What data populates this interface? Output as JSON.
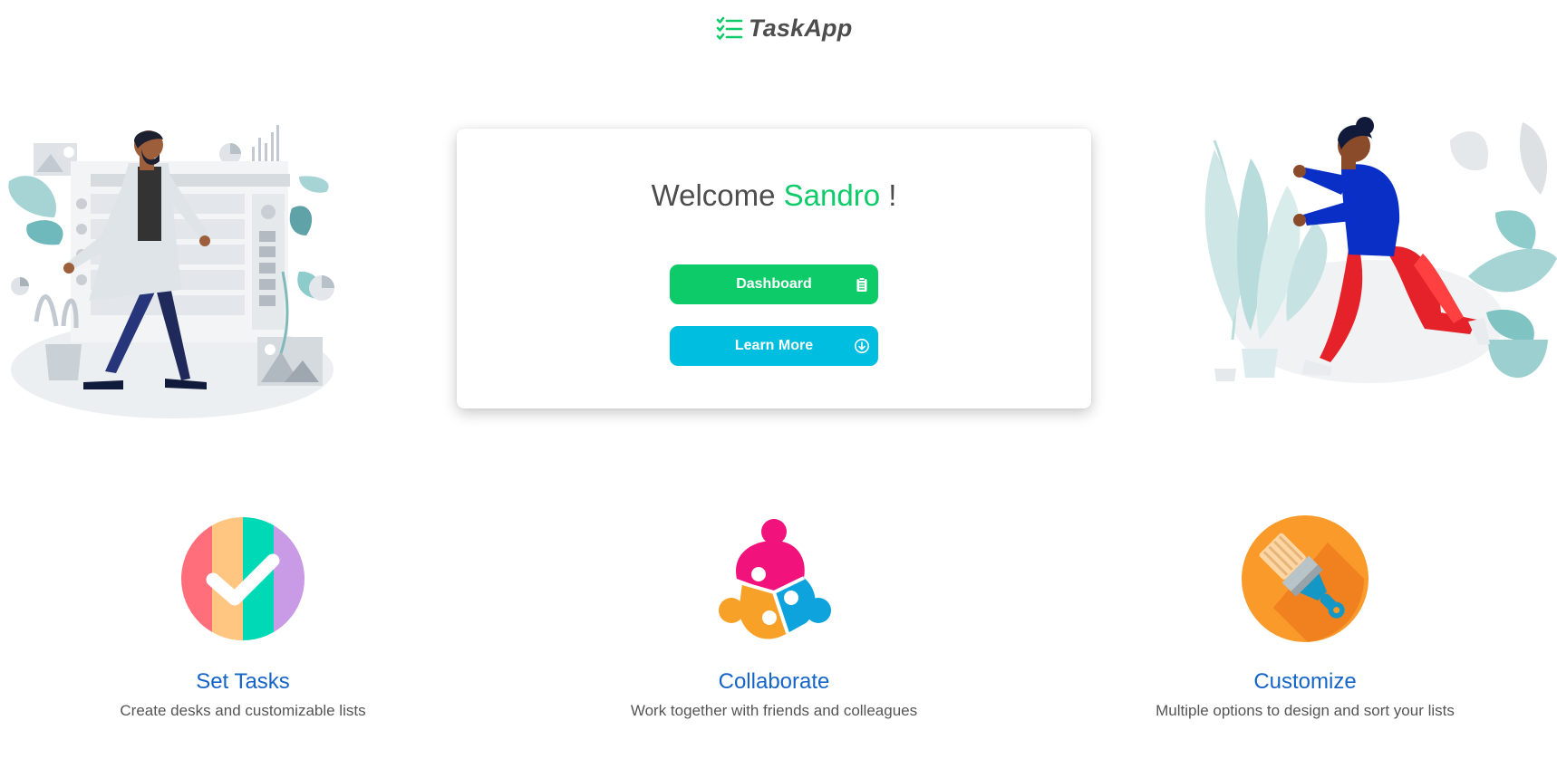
{
  "header": {
    "brand": "TaskApp",
    "logo_icon": "checklist-icon",
    "brand_color": "#0ecb6a"
  },
  "welcome_card": {
    "greeting": "Welcome",
    "user_name": "Sandro",
    "exclamation": "!",
    "dashboard_label": "Dashboard",
    "dashboard_icon": "clipboard-icon",
    "learn_more_label": "Learn More",
    "learn_more_icon": "arrow-down-circle-icon",
    "dashboard_color": "#0ecb6a",
    "learn_more_color": "#00bedf"
  },
  "features": [
    {
      "title": "Set Tasks",
      "description": "Create desks and customizable lists",
      "icon": "checkmark-stripes-icon"
    },
    {
      "title": "Collaborate",
      "description": "Work together with friends and colleagues",
      "icon": "puzzle-people-icon"
    },
    {
      "title": "Customize",
      "description": "Multiple options to design and sort your lists",
      "icon": "paintbrush-icon"
    }
  ],
  "colors": {
    "heading_blue": "#1565c8",
    "text_gray": "#4d4d4d"
  }
}
